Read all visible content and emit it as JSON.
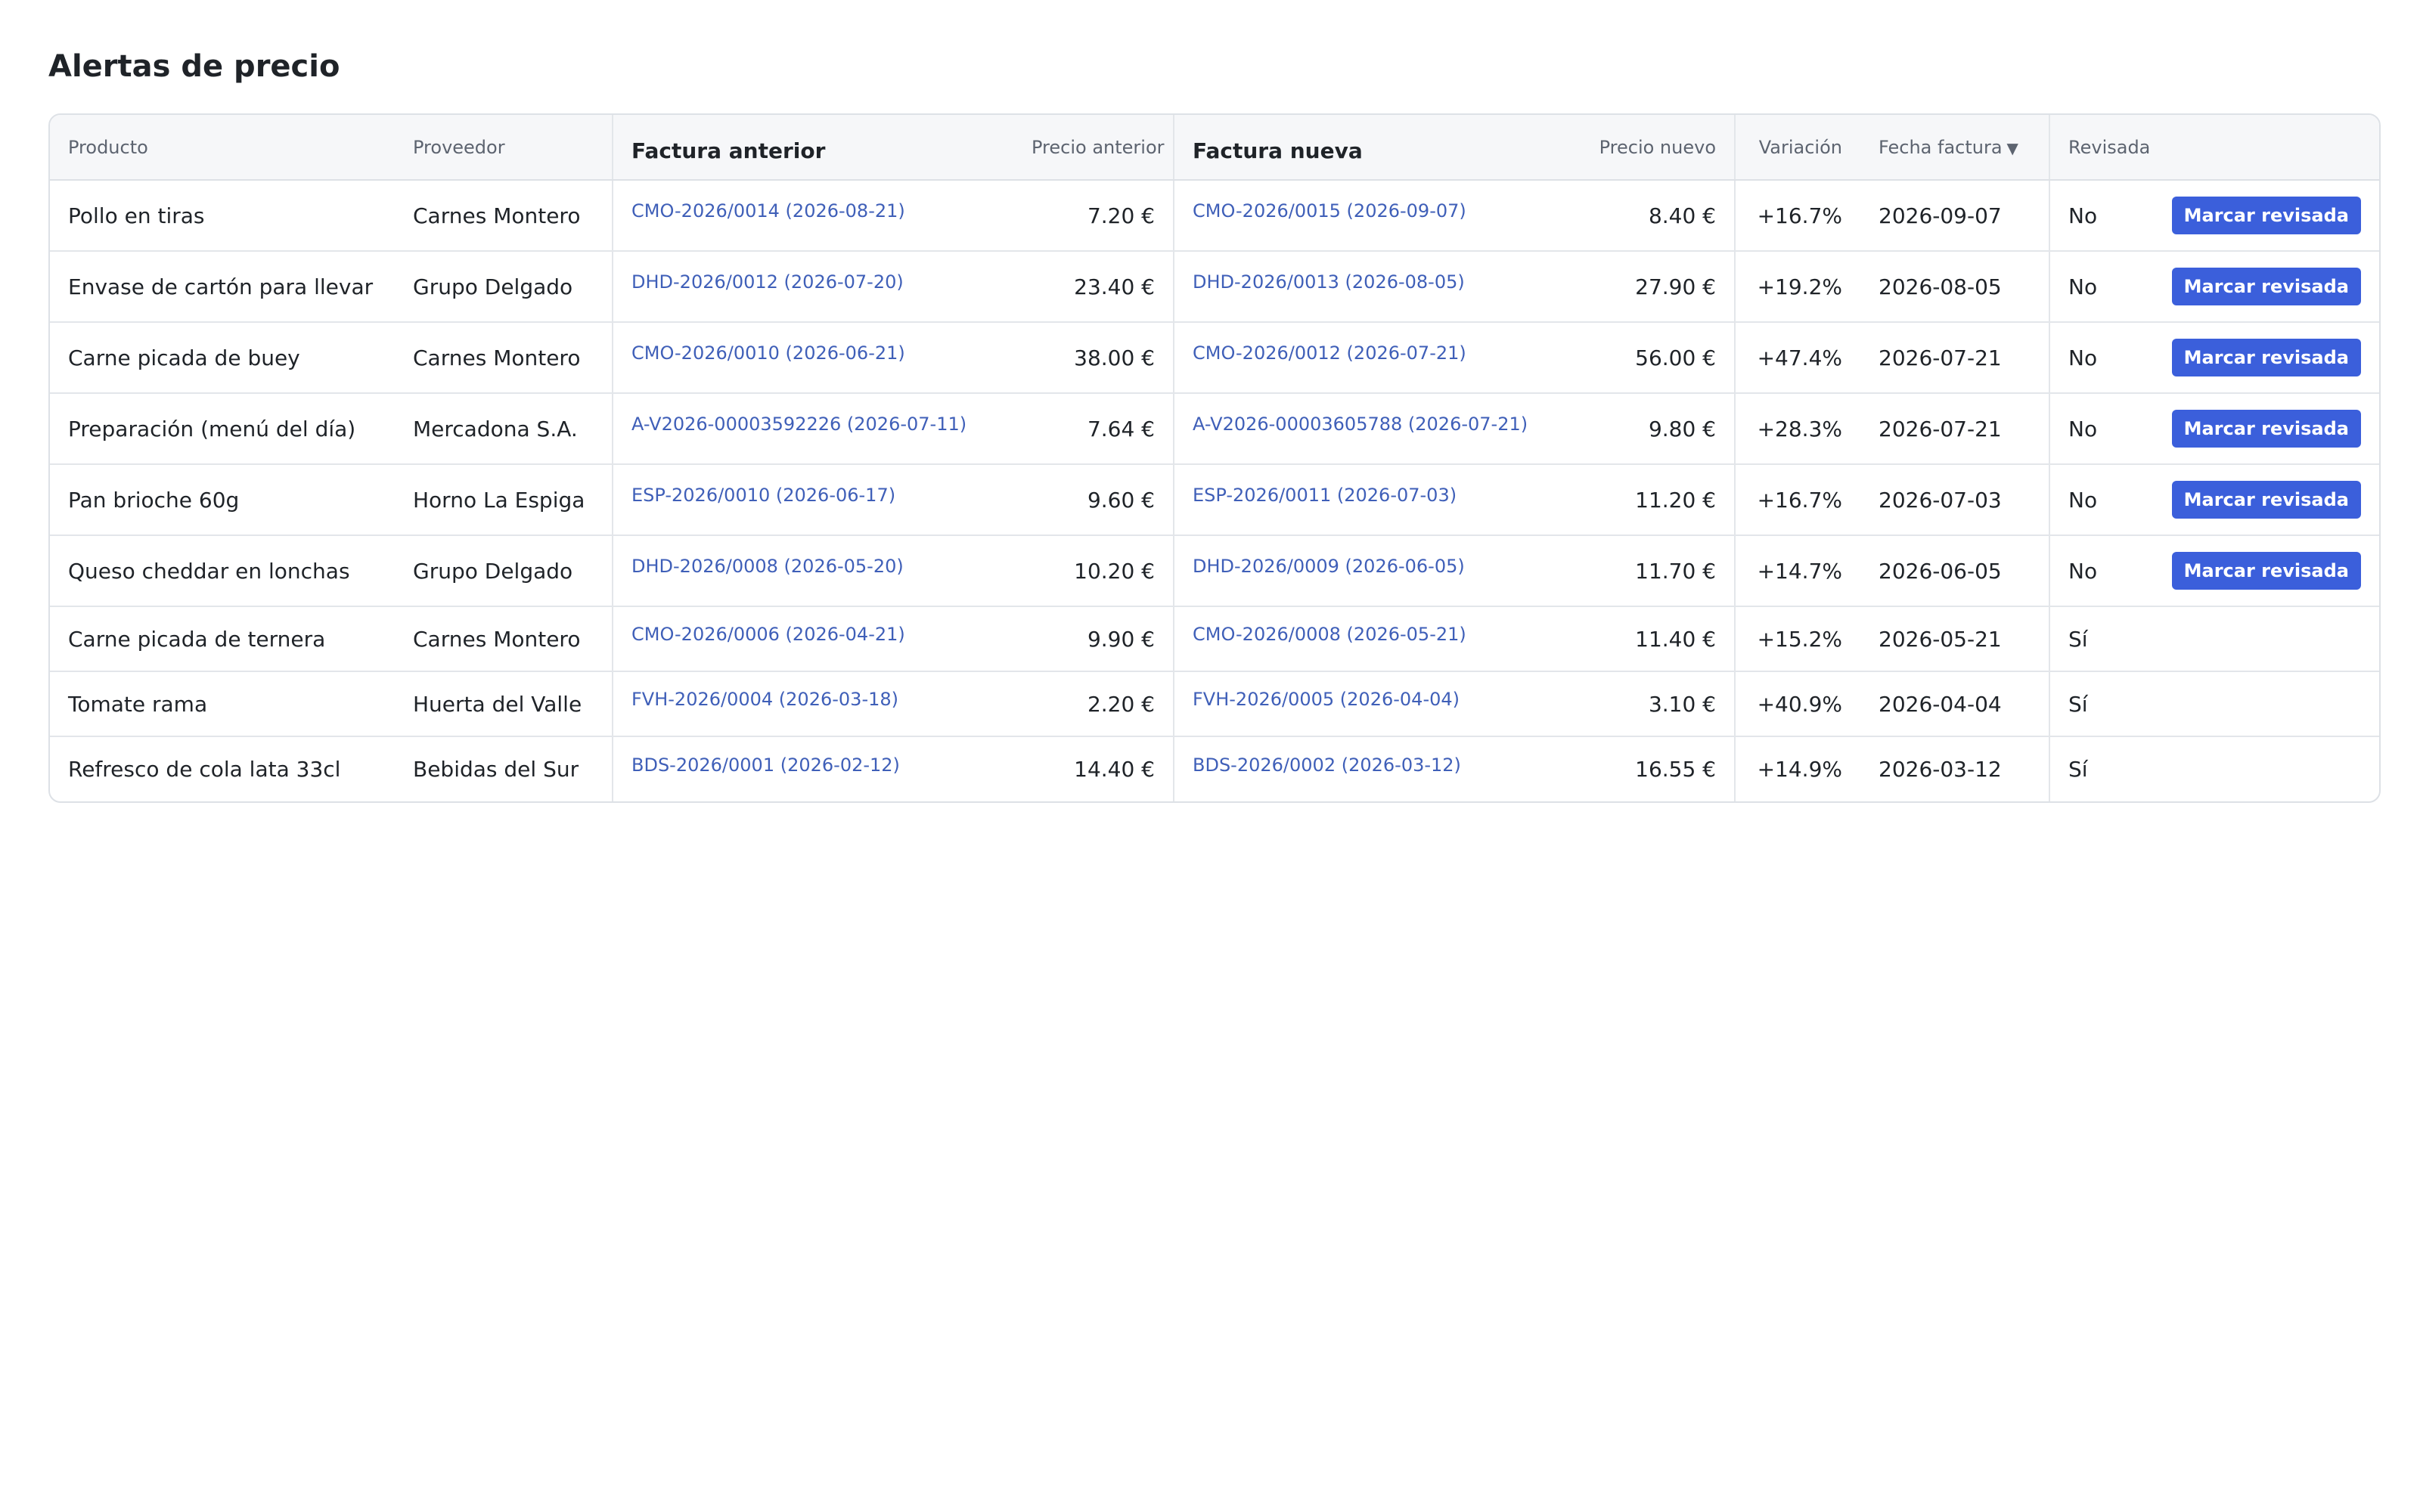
{
  "page": {
    "title": "Alertas de precio"
  },
  "table": {
    "headers": {
      "producto": "Producto",
      "proveedor": "Proveedor",
      "factura_anterior": "Factura anterior",
      "precio_anterior": "Precio anterior",
      "factura_nueva": "Factura nueva",
      "precio_nuevo": "Precio nuevo",
      "variacion": "Variación",
      "fecha_factura": "Fecha factura",
      "revisada": "Revisada"
    },
    "sort_indicator": "▼",
    "review_button_label": "Marcar revisada",
    "rows": [
      {
        "producto": "Pollo en tiras",
        "proveedor": "Carnes Montero",
        "factura_anterior": "CMO-2026/0014 (2026-08-21)",
        "precio_anterior": "7.20 €",
        "factura_nueva": "CMO-2026/0015 (2026-09-07)",
        "precio_nuevo": "8.40 €",
        "variacion": "+16.7%",
        "fecha_factura": "2026-09-07",
        "revisada": "No"
      },
      {
        "producto": "Envase de cartón para llevar",
        "proveedor": "Grupo Delgado",
        "factura_anterior": "DHD-2026/0012 (2026-07-20)",
        "precio_anterior": "23.40 €",
        "factura_nueva": "DHD-2026/0013 (2026-08-05)",
        "precio_nuevo": "27.90 €",
        "variacion": "+19.2%",
        "fecha_factura": "2026-08-05",
        "revisada": "No"
      },
      {
        "producto": "Carne picada de buey",
        "proveedor": "Carnes Montero",
        "factura_anterior": "CMO-2026/0010 (2026-06-21)",
        "precio_anterior": "38.00 €",
        "factura_nueva": "CMO-2026/0012 (2026-07-21)",
        "precio_nuevo": "56.00 €",
        "variacion": "+47.4%",
        "fecha_factura": "2026-07-21",
        "revisada": "No"
      },
      {
        "producto": "Preparación (menú del día)",
        "proveedor": "Mercadona S.A.",
        "factura_anterior": "A-V2026-00003592226 (2026-07-11)",
        "precio_anterior": "7.64 €",
        "factura_nueva": "A-V2026-00003605788 (2026-07-21)",
        "precio_nuevo": "9.80 €",
        "variacion": "+28.3%",
        "fecha_factura": "2026-07-21",
        "revisada": "No"
      },
      {
        "producto": "Pan brioche 60g",
        "proveedor": "Horno La Espiga",
        "factura_anterior": "ESP-2026/0010 (2026-06-17)",
        "precio_anterior": "9.60 €",
        "factura_nueva": "ESP-2026/0011 (2026-07-03)",
        "precio_nuevo": "11.20 €",
        "variacion": "+16.7%",
        "fecha_factura": "2026-07-03",
        "revisada": "No"
      },
      {
        "producto": "Queso cheddar en lonchas",
        "proveedor": "Grupo Delgado",
        "factura_anterior": "DHD-2026/0008 (2026-05-20)",
        "precio_anterior": "10.20 €",
        "factura_nueva": "DHD-2026/0009 (2026-06-05)",
        "precio_nuevo": "11.70 €",
        "variacion": "+14.7%",
        "fecha_factura": "2026-06-05",
        "revisada": "No"
      },
      {
        "producto": "Carne picada de ternera",
        "proveedor": "Carnes Montero",
        "factura_anterior": "CMO-2026/0006 (2026-04-21)",
        "precio_anterior": "9.90 €",
        "factura_nueva": "CMO-2026/0008 (2026-05-21)",
        "precio_nuevo": "11.40 €",
        "variacion": "+15.2%",
        "fecha_factura": "2026-05-21",
        "revisada": "Sí"
      },
      {
        "producto": "Tomate rama",
        "proveedor": "Huerta del Valle",
        "factura_anterior": "FVH-2026/0004 (2026-03-18)",
        "precio_anterior": "2.20 €",
        "factura_nueva": "FVH-2026/0005 (2026-04-04)",
        "precio_nuevo": "3.10 €",
        "variacion": "+40.9%",
        "fecha_factura": "2026-04-04",
        "revisada": "Sí"
      },
      {
        "producto": "Refresco de cola lata 33cl",
        "proveedor": "Bebidas del Sur",
        "factura_anterior": "BDS-2026/0001 (2026-02-12)",
        "precio_anterior": "14.40 €",
        "factura_nueva": "BDS-2026/0002 (2026-03-12)",
        "precio_nuevo": "16.55 €",
        "variacion": "+14.9%",
        "fecha_factura": "2026-03-12",
        "revisada": "Sí"
      }
    ]
  },
  "colors": {
    "accent_button": "#3b5fdb",
    "link": "#3f5fb8",
    "header_bg": "#f6f7f9",
    "border": "#dde1e6"
  }
}
